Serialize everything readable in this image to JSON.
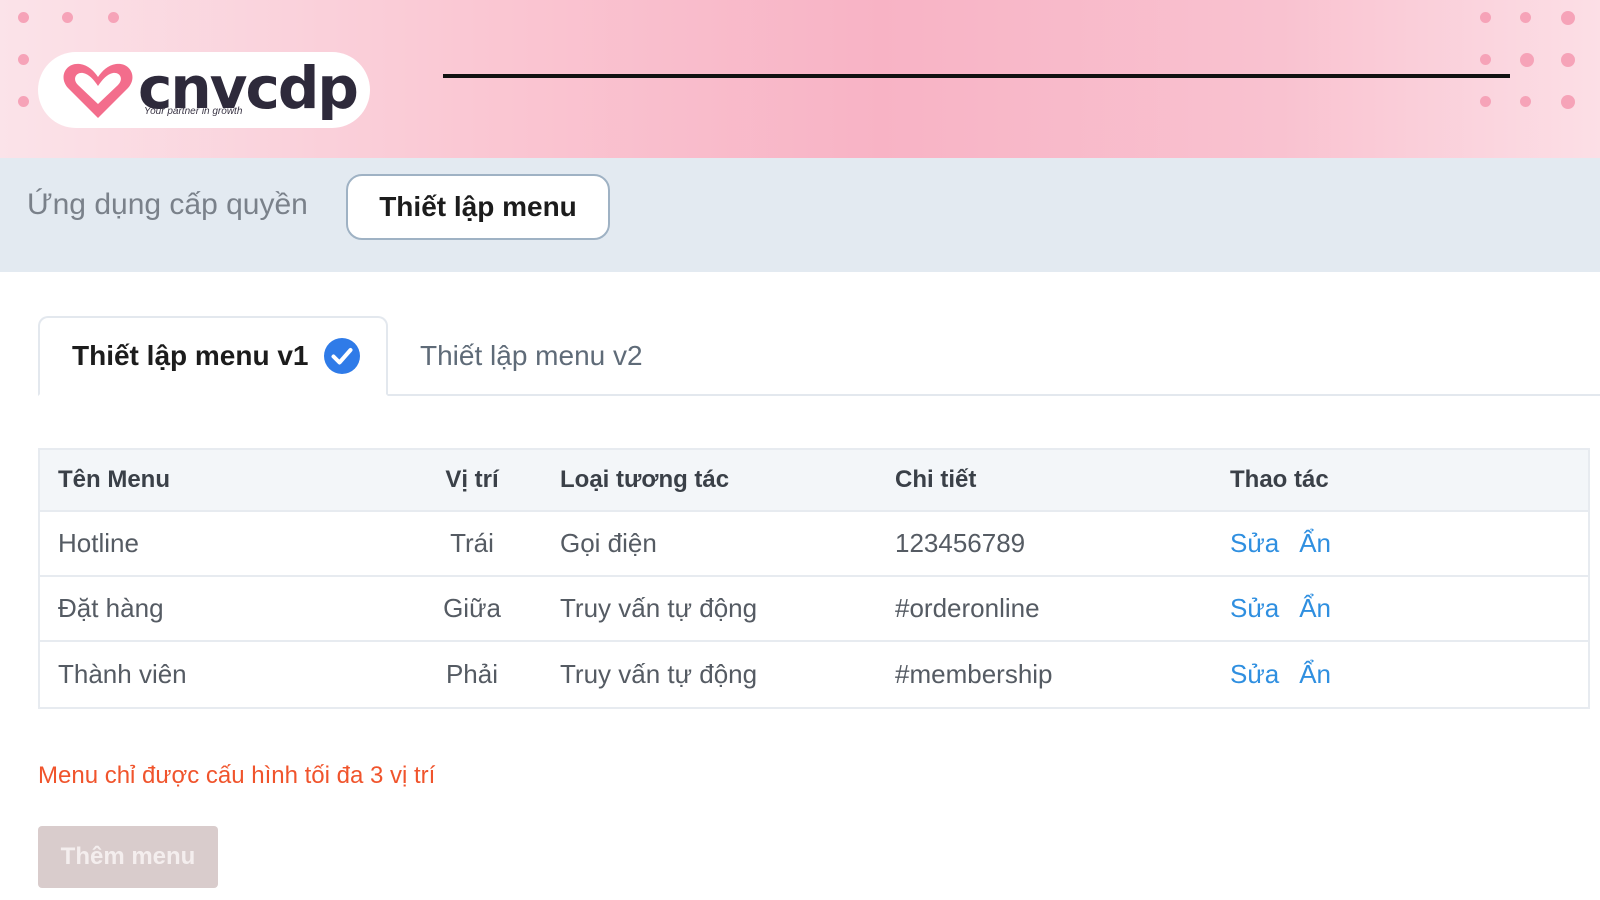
{
  "brand": {
    "name": "cnvcdp",
    "tagline": "Your partner in growth",
    "colors": {
      "heart": "#f36d8c",
      "text": "#2e2a3b"
    }
  },
  "topnav": {
    "items": [
      {
        "label": "Ứng dụng cấp quyền",
        "active": false
      },
      {
        "label": "Thiết lập menu",
        "active": true
      }
    ]
  },
  "tabs": [
    {
      "label": "Thiết lập menu v1",
      "active": true,
      "icon": "check-circle-icon"
    },
    {
      "label": "Thiết lập menu v2",
      "active": false
    }
  ],
  "table": {
    "columns": [
      "Tên Menu",
      "Vị trí",
      "Loại tương tác",
      "Chi tiết",
      "Thao tác"
    ],
    "rows": [
      {
        "name": "Hotline",
        "position": "Trái",
        "type": "Gọi điện",
        "detail": "123456789",
        "edit": "Sửa",
        "hide": "Ẩn"
      },
      {
        "name": "Đặt hàng",
        "position": "Giữa",
        "type": "Truy vấn tự động",
        "detail": "#orderonline",
        "edit": "Sửa",
        "hide": "Ẩn"
      },
      {
        "name": "Thành viên",
        "position": "Phải",
        "type": "Truy vấn tự động",
        "detail": "#membership",
        "edit": "Sửa",
        "hide": "Ẩn"
      }
    ]
  },
  "note": "Menu chỉ được cấu hình tối đa 3 vị trí",
  "add_button": {
    "label": "Thêm menu",
    "disabled": true
  },
  "colors": {
    "accent_link": "#2f8fe0",
    "warning": "#f0542c",
    "check": "#2f7be8",
    "disabled_button": "#d9cccc"
  }
}
